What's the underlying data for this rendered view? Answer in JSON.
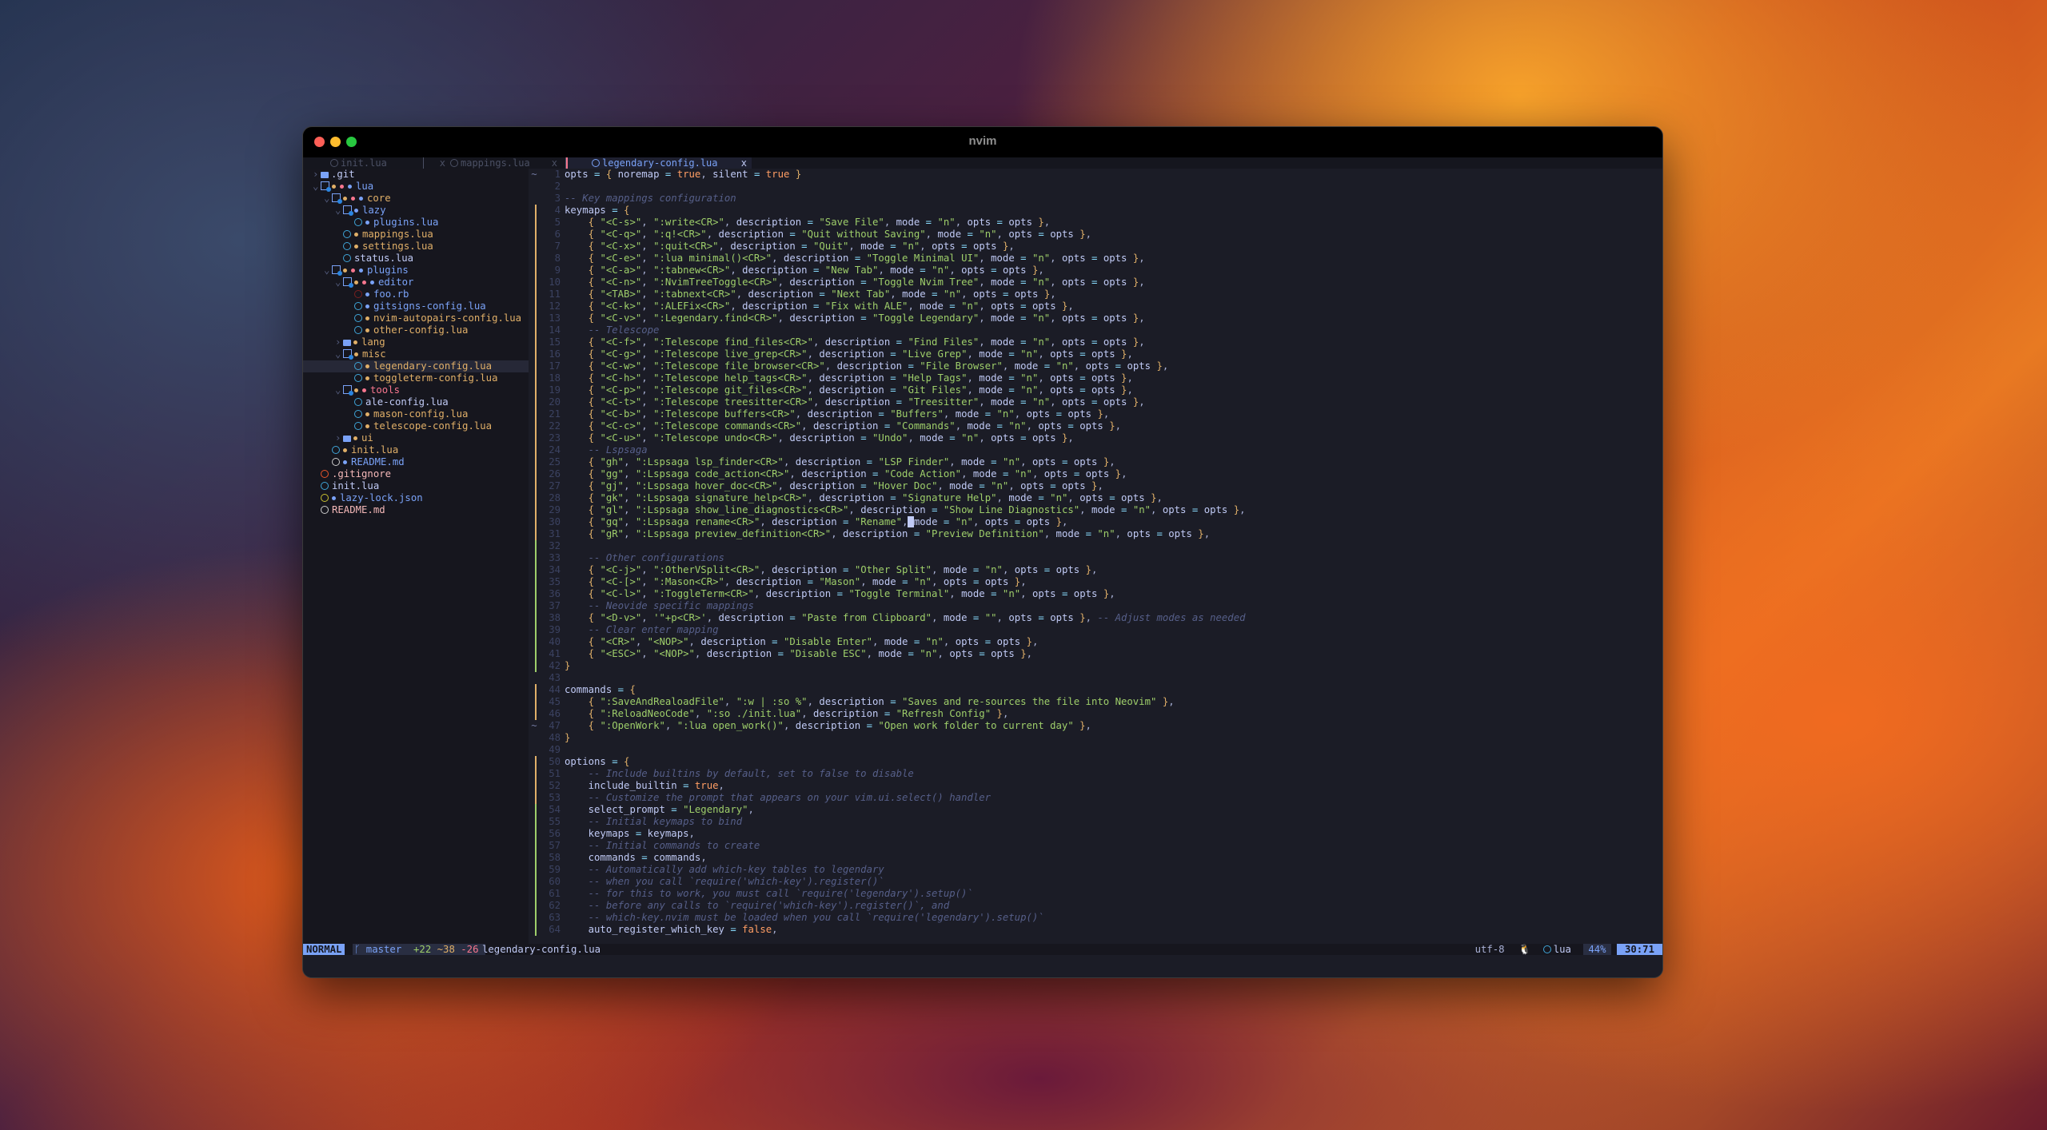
{
  "window": {
    "title": "nvim"
  },
  "tabs": [
    {
      "label": "init.lua",
      "active": false
    },
    {
      "label": "mappings.lua",
      "active": false
    },
    {
      "label": "legendary-config.lua",
      "active": true
    }
  ],
  "tab_close_glyph": "x",
  "tree": [
    {
      "depth": 0,
      "chev": ">",
      "kind": "folder",
      "dots": [],
      "name": ".git",
      "color": "wht"
    },
    {
      "depth": 0,
      "chev": "v",
      "kind": "folder-open",
      "dots": [
        "y",
        "r",
        "b"
      ],
      "name": "lua",
      "color": "blue"
    },
    {
      "depth": 1,
      "chev": "v",
      "kind": "folder-open",
      "dots": [
        "y",
        "r",
        "b"
      ],
      "name": "core",
      "color": "yel"
    },
    {
      "depth": 2,
      "chev": "v",
      "kind": "folder-open",
      "dots": [
        "b"
      ],
      "name": "lazy",
      "color": "blue"
    },
    {
      "depth": 3,
      "chev": "",
      "kind": "file",
      "dots": [
        "b"
      ],
      "name": "plugins.lua",
      "color": "blue"
    },
    {
      "depth": 2,
      "chev": "",
      "kind": "file",
      "dots": [
        "y"
      ],
      "name": "mappings.lua",
      "color": "yel"
    },
    {
      "depth": 2,
      "chev": "",
      "kind": "file",
      "dots": [
        "y"
      ],
      "name": "settings.lua",
      "color": "yel"
    },
    {
      "depth": 2,
      "chev": "",
      "kind": "file",
      "dots": [],
      "name": "status.lua",
      "color": "wht"
    },
    {
      "depth": 1,
      "chev": "v",
      "kind": "folder-open",
      "dots": [
        "y",
        "r",
        "b"
      ],
      "name": "plugins",
      "color": "blue"
    },
    {
      "depth": 2,
      "chev": "v",
      "kind": "folder-open",
      "dots": [
        "y",
        "r",
        "b"
      ],
      "name": "editor",
      "color": "blue"
    },
    {
      "depth": 3,
      "chev": "",
      "kind": "file-red",
      "dots": [
        "b"
      ],
      "name": "foo.rb",
      "color": "blue"
    },
    {
      "depth": 3,
      "chev": "",
      "kind": "file",
      "dots": [
        "b"
      ],
      "name": "gitsigns-config.lua",
      "color": "blue"
    },
    {
      "depth": 3,
      "chev": "",
      "kind": "file",
      "dots": [
        "y"
      ],
      "name": "nvim-autopairs-config.lua",
      "color": "yel"
    },
    {
      "depth": 3,
      "chev": "",
      "kind": "file",
      "dots": [
        "y"
      ],
      "name": "other-config.lua",
      "color": "yel"
    },
    {
      "depth": 2,
      "chev": ">",
      "kind": "folder",
      "dots": [
        "y"
      ],
      "name": "lang",
      "color": "yel"
    },
    {
      "depth": 2,
      "chev": "v",
      "kind": "folder-open",
      "dots": [
        "y"
      ],
      "name": "misc",
      "color": "yel"
    },
    {
      "depth": 3,
      "chev": "",
      "kind": "file",
      "dots": [
        "y"
      ],
      "name": "legendary-config.lua",
      "color": "yel",
      "selected": true
    },
    {
      "depth": 3,
      "chev": "",
      "kind": "file",
      "dots": [
        "y"
      ],
      "name": "toggleterm-config.lua",
      "color": "yel"
    },
    {
      "depth": 2,
      "chev": "v",
      "kind": "folder-open",
      "dots": [
        "y",
        "r"
      ],
      "name": "tools",
      "color": "pink"
    },
    {
      "depth": 3,
      "chev": "",
      "kind": "file",
      "dots": [],
      "name": "ale-config.lua",
      "color": "wht"
    },
    {
      "depth": 3,
      "chev": "",
      "kind": "file",
      "dots": [
        "y"
      ],
      "name": "mason-config.lua",
      "color": "yel"
    },
    {
      "depth": 3,
      "chev": "",
      "kind": "file",
      "dots": [
        "y"
      ],
      "name": "telescope-config.lua",
      "color": "yel"
    },
    {
      "depth": 2,
      "chev": ">",
      "kind": "folder",
      "dots": [
        "y"
      ],
      "name": "ui",
      "color": "yel"
    },
    {
      "depth": 1,
      "chev": "",
      "kind": "file",
      "dots": [
        "y"
      ],
      "name": "init.lua",
      "color": "yel"
    },
    {
      "depth": 1,
      "chev": "",
      "kind": "file-gray",
      "dots": [
        "b"
      ],
      "name": "README.md",
      "color": "blue"
    },
    {
      "depth": 0,
      "chev": "",
      "kind": "file-orange",
      "dots": [],
      "name": ".gitignore",
      "color": "rose"
    },
    {
      "depth": 0,
      "chev": "",
      "kind": "file",
      "dots": [],
      "name": "init.lua",
      "color": "wht"
    },
    {
      "depth": 0,
      "chev": "",
      "kind": "file-olive",
      "dots": [
        "b"
      ],
      "name": "lazy-lock.json",
      "color": "blue"
    },
    {
      "depth": 0,
      "chev": "",
      "kind": "file-gray",
      "dots": [],
      "name": "README.md",
      "color": "rose"
    }
  ],
  "code": [
    {
      "n": 1,
      "sign": "~",
      "bar": "",
      "t": "opts = { noremap = true, silent = true }"
    },
    {
      "n": 2,
      "sign": "",
      "bar": "",
      "t": ""
    },
    {
      "n": 3,
      "sign": "",
      "bar": "",
      "t": "-- Key mappings configuration"
    },
    {
      "n": 4,
      "sign": "",
      "bar": "y",
      "t": "keymaps = {"
    },
    {
      "n": 5,
      "sign": "",
      "bar": "y",
      "t": "    { \"<C-s>\", \":write<CR>\", description = \"Save File\", mode = \"n\", opts = opts },"
    },
    {
      "n": 6,
      "sign": "",
      "bar": "y",
      "t": "    { \"<C-q>\", \":q!<CR>\", description = \"Quit without Saving\", mode = \"n\", opts = opts },"
    },
    {
      "n": 7,
      "sign": "",
      "bar": "y",
      "t": "    { \"<C-x>\", \":quit<CR>\", description = \"Quit\", mode = \"n\", opts = opts },"
    },
    {
      "n": 8,
      "sign": "",
      "bar": "y",
      "t": "    { \"<C-e>\", \":lua minimal()<CR>\", description = \"Toggle Minimal UI\", mode = \"n\", opts = opts },"
    },
    {
      "n": 9,
      "sign": "",
      "bar": "y",
      "t": "    { \"<C-a>\", \":tabnew<CR>\", description = \"New Tab\", mode = \"n\", opts = opts },"
    },
    {
      "n": 10,
      "sign": "",
      "bar": "y",
      "t": "    { \"<C-n>\", \":NvimTreeToggle<CR>\", description = \"Toggle Nvim Tree\", mode = \"n\", opts = opts },"
    },
    {
      "n": 11,
      "sign": "",
      "bar": "y",
      "t": "    { \"<TAB>\", \":tabnext<CR>\", description = \"Next Tab\", mode = \"n\", opts = opts },"
    },
    {
      "n": 12,
      "sign": "",
      "bar": "y",
      "t": "    { \"<C-k>\", \":ALEFix<CR>\", description = \"Fix with ALE\", mode = \"n\", opts = opts },"
    },
    {
      "n": 13,
      "sign": "",
      "bar": "y",
      "t": "    { \"<C-v>\", \":Legendary.find<CR>\", description = \"Toggle Legendary\", mode = \"n\", opts = opts },"
    },
    {
      "n": 14,
      "sign": "",
      "bar": "y",
      "t": "    -- Telescope"
    },
    {
      "n": 15,
      "sign": "",
      "bar": "y",
      "t": "    { \"<C-f>\", \":Telescope find_files<CR>\", description = \"Find Files\", mode = \"n\", opts = opts },"
    },
    {
      "n": 16,
      "sign": "",
      "bar": "y",
      "t": "    { \"<C-g>\", \":Telescope live_grep<CR>\", description = \"Live Grep\", mode = \"n\", opts = opts },"
    },
    {
      "n": 17,
      "sign": "",
      "bar": "y",
      "t": "    { \"<C-w>\", \":Telescope file_browser<CR>\", description = \"File Browser\", mode = \"n\", opts = opts },"
    },
    {
      "n": 18,
      "sign": "",
      "bar": "y",
      "t": "    { \"<C-h>\", \":Telescope help_tags<CR>\", description = \"Help Tags\", mode = \"n\", opts = opts },"
    },
    {
      "n": 19,
      "sign": "",
      "bar": "y",
      "t": "    { \"<C-p>\", \":Telescope git_files<CR>\", description = \"Git Files\", mode = \"n\", opts = opts },"
    },
    {
      "n": 20,
      "sign": "",
      "bar": "y",
      "t": "    { \"<C-t>\", \":Telescope treesitter<CR>\", description = \"Treesitter\", mode = \"n\", opts = opts },"
    },
    {
      "n": 21,
      "sign": "",
      "bar": "y",
      "t": "    { \"<C-b>\", \":Telescope buffers<CR>\", description = \"Buffers\", mode = \"n\", opts = opts },"
    },
    {
      "n": 22,
      "sign": "",
      "bar": "y",
      "t": "    { \"<C-c>\", \":Telescope commands<CR>\", description = \"Commands\", mode = \"n\", opts = opts },"
    },
    {
      "n": 23,
      "sign": "",
      "bar": "y",
      "t": "    { \"<C-u>\", \":Telescope undo<CR>\", description = \"Undo\", mode = \"n\", opts = opts },"
    },
    {
      "n": 24,
      "sign": "",
      "bar": "y",
      "t": "    -- Lspsaga"
    },
    {
      "n": 25,
      "sign": "",
      "bar": "y",
      "t": "    { \"gh\", \":Lspsaga lsp_finder<CR>\", description = \"LSP Finder\", mode = \"n\", opts = opts },"
    },
    {
      "n": 26,
      "sign": "",
      "bar": "y",
      "t": "    { \"gg\", \":Lspsaga code_action<CR>\", description = \"Code Action\", mode = \"n\", opts = opts },"
    },
    {
      "n": 27,
      "sign": "",
      "bar": "y",
      "t": "    { \"gj\", \":Lspsaga hover_doc<CR>\", description = \"Hover Doc\", mode = \"n\", opts = opts },"
    },
    {
      "n": 28,
      "sign": "",
      "bar": "y",
      "t": "    { \"gk\", \":Lspsaga signature_help<CR>\", description = \"Signature Help\", mode = \"n\", opts = opts },"
    },
    {
      "n": 29,
      "sign": "",
      "bar": "y",
      "t": "    { \"gl\", \":Lspsaga show_line_diagnostics<CR>\", description = \"Show Line Diagnostics\", mode = \"n\", opts = opts },"
    },
    {
      "n": 30,
      "sign": "",
      "bar": "y",
      "t": "    { \"gq\", \":Lspsaga rename<CR>\", description = \"Rename\", mode = \"n\", opts = opts },",
      "cursor": 58
    },
    {
      "n": 31,
      "sign": "",
      "bar": "y",
      "t": "    { \"gR\", \":Lspsaga preview_definition<CR>\", description = \"Preview Definition\", mode = \"n\", opts = opts },"
    },
    {
      "n": 32,
      "sign": "",
      "bar": "g",
      "t": ""
    },
    {
      "n": 33,
      "sign": "",
      "bar": "g",
      "t": "    -- Other configurations"
    },
    {
      "n": 34,
      "sign": "",
      "bar": "g",
      "t": "    { \"<C-j>\", \":OtherVSplit<CR>\", description = \"Other Split\", mode = \"n\", opts = opts },"
    },
    {
      "n": 35,
      "sign": "",
      "bar": "g",
      "t": "    { \"<C-[>\", \":Mason<CR>\", description = \"Mason\", mode = \"n\", opts = opts },"
    },
    {
      "n": 36,
      "sign": "",
      "bar": "g",
      "t": "    { \"<C-l>\", \":ToggleTerm<CR>\", description = \"Toggle Terminal\", mode = \"n\", opts = opts },"
    },
    {
      "n": 37,
      "sign": "",
      "bar": "g",
      "t": "    -- Neovide specific mappings"
    },
    {
      "n": 38,
      "sign": "",
      "bar": "g",
      "t": "    { \"<D-v>\", '\"+p<CR>', description = \"Paste from Clipboard\", mode = \"\", opts = opts }, -- Adjust modes as needed"
    },
    {
      "n": 39,
      "sign": "",
      "bar": "g",
      "t": "    -- Clear enter mapping"
    },
    {
      "n": 40,
      "sign": "",
      "bar": "g",
      "t": "    { \"<CR>\", \"<NOP>\", description = \"Disable Enter\", mode = \"n\", opts = opts },"
    },
    {
      "n": 41,
      "sign": "",
      "bar": "g",
      "t": "    { \"<ESC>\", \"<NOP>\", description = \"Disable ESC\", mode = \"n\", opts = opts },"
    },
    {
      "n": 42,
      "sign": "",
      "bar": "g",
      "t": "}"
    },
    {
      "n": 43,
      "sign": "",
      "bar": "",
      "t": ""
    },
    {
      "n": 44,
      "sign": "",
      "bar": "y",
      "t": "commands = {"
    },
    {
      "n": 45,
      "sign": "",
      "bar": "y",
      "t": "    { \":SaveAndRealoadFile\", \":w | :so %\", description = \"Saves and re-sources the file into Neovim\" },"
    },
    {
      "n": 46,
      "sign": "",
      "bar": "y",
      "t": "    { \":ReloadNeoCode\", \":so ./init.lua\", description = \"Refresh Config\" },"
    },
    {
      "n": 47,
      "sign": "~",
      "bar": "",
      "t": "    { \":OpenWork\", \":lua open_work()\", description = \"Open work folder to current day\" },"
    },
    {
      "n": 48,
      "sign": "",
      "bar": "",
      "t": "}"
    },
    {
      "n": 49,
      "sign": "",
      "bar": "",
      "t": ""
    },
    {
      "n": 50,
      "sign": "",
      "bar": "y",
      "t": "options = {"
    },
    {
      "n": 51,
      "sign": "",
      "bar": "y",
      "t": "    -- Include builtins by default, set to false to disable"
    },
    {
      "n": 52,
      "sign": "",
      "bar": "y",
      "t": "    include_builtin = true,"
    },
    {
      "n": 53,
      "sign": "",
      "bar": "y",
      "t": "    -- Customize the prompt that appears on your vim.ui.select() handler"
    },
    {
      "n": 54,
      "sign": "",
      "bar": "g",
      "t": "    select_prompt = \"Legendary\","
    },
    {
      "n": 55,
      "sign": "",
      "bar": "g",
      "t": "    -- Initial keymaps to bind"
    },
    {
      "n": 56,
      "sign": "",
      "bar": "g",
      "t": "    keymaps = keymaps,"
    },
    {
      "n": 57,
      "sign": "",
      "bar": "g",
      "t": "    -- Initial commands to create"
    },
    {
      "n": 58,
      "sign": "",
      "bar": "g",
      "t": "    commands = commands,"
    },
    {
      "n": 59,
      "sign": "",
      "bar": "g",
      "t": "    -- Automatically add which-key tables to legendary"
    },
    {
      "n": 60,
      "sign": "",
      "bar": "g",
      "t": "    -- when you call `require('which-key').register()`"
    },
    {
      "n": 61,
      "sign": "",
      "bar": "g",
      "t": "    -- for this to work, you must call `require('legendary').setup()`"
    },
    {
      "n": 62,
      "sign": "",
      "bar": "g",
      "t": "    -- before any calls to `require('which-key').register()`, and"
    },
    {
      "n": 63,
      "sign": "",
      "bar": "g",
      "t": "    -- which-key.nvim must be loaded when you call `require('legendary').setup()`"
    },
    {
      "n": 64,
      "sign": "",
      "bar": "g",
      "t": "    auto_register_which_key = false,"
    }
  ],
  "statusline": {
    "mode": "NORMAL",
    "branch_icon": "branch-icon",
    "branch": "master",
    "added": "+22",
    "changed": "~38",
    "removed": "-26",
    "filename": "legendary-config.lua",
    "encoding": "utf-8",
    "os_icon": "linux-icon",
    "filetype": "lua",
    "percent": "44%",
    "position": "30:71"
  },
  "colors": {
    "accent": "#7aa2f7",
    "string": "#9ece6a",
    "operator": "#89ddff",
    "brace": "#e0af68",
    "boolean": "#ff9e64",
    "comment": "#565f89",
    "background": "#1b1c26"
  }
}
